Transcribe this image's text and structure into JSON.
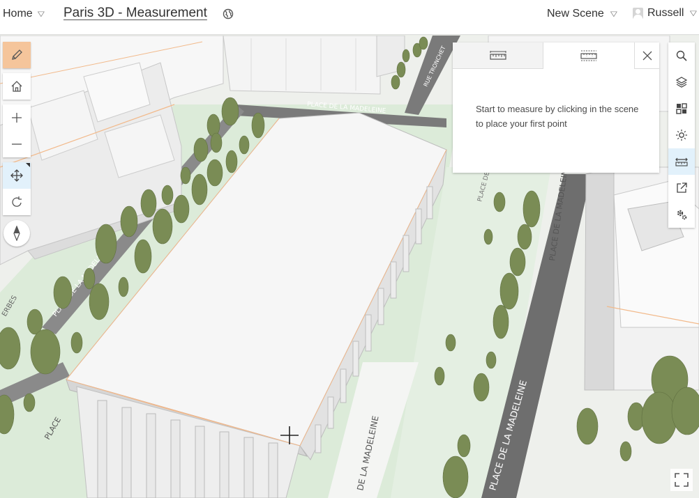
{
  "header": {
    "home_label": "Home",
    "title": "Paris 3D - Measurement",
    "new_scene_label": "New Scene",
    "user_name": "Russell"
  },
  "map_labels": {
    "madeleine_top": "PLACE DE LA MADELEINE",
    "madeleine_left": "PLACE DE LA MADELEINE",
    "madeleine_bottom": "DE LA MADELEINE",
    "madeleine_right_vertical": "PLACE DE LA MADELEINE",
    "madeleine_right_bottom": "PLACE DE LA MADELEINE",
    "place_de_right": "PLACE DE",
    "place_left_bottom": "PLACE",
    "rue_top": "RUE TRONCHET",
    "erbes": "ERBES"
  },
  "measure_panel": {
    "message": "Start to measure by clicking in the scene to place your first point",
    "tabs": [
      "distance-measurement",
      "area-measurement"
    ],
    "active_tab": 1
  },
  "left_toolbar": [
    "pencil",
    "home",
    "zoom-in",
    "zoom-out",
    "pan",
    "rotate",
    "compass"
  ],
  "right_toolbar": [
    "search",
    "layers",
    "basemap-gallery",
    "daylight",
    "measurement",
    "share",
    "settings"
  ],
  "colors": {
    "accent": "#f5c59b",
    "active_tool": "#e2f1fb",
    "tree": "#7a8c55",
    "road": "#6e6e6e",
    "grass": "#dceede"
  }
}
